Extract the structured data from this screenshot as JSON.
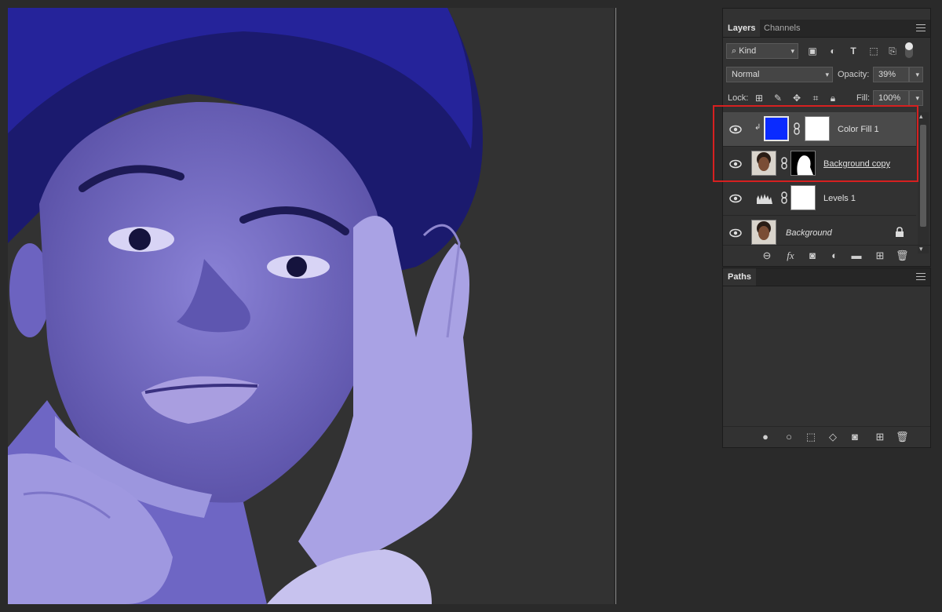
{
  "panels": {
    "collapse_symbol": "«",
    "close_symbol": "×",
    "layers": {
      "tabs": [
        "Layers",
        "Channels"
      ],
      "kind_filter": "Kind",
      "blend_mode": "Normal",
      "opacity_label": "Opacity:",
      "opacity_value": "39%",
      "lock_label": "Lock:",
      "fill_label": "Fill:",
      "fill_value": "100%",
      "layers": [
        {
          "name": "Color Fill 1",
          "selected": true,
          "italic": false,
          "underline": false
        },
        {
          "name": "Background copy",
          "selected": false,
          "italic": false,
          "underline": true
        },
        {
          "name": "Levels 1",
          "selected": false,
          "italic": false,
          "underline": false
        },
        {
          "name": "Background",
          "selected": false,
          "italic": true,
          "underline": false
        }
      ],
      "footer_icons": [
        "link-layers-icon",
        "fx-icon",
        "add-mask-icon",
        "adjustment-layer-icon",
        "new-group-icon",
        "new-layer-icon",
        "delete-layer-icon"
      ]
    },
    "paths": {
      "title": "Paths",
      "footer_icons": [
        "fill-path-icon",
        "stroke-path-icon",
        "load-selection-icon",
        "make-work-path-icon",
        "add-mask-icon",
        "new-path-icon",
        "delete-path-icon"
      ]
    }
  },
  "colors": {
    "accent_fill": "#0a2bff",
    "highlight": "#d62020",
    "canvas_tint": "#5a5ad6"
  }
}
